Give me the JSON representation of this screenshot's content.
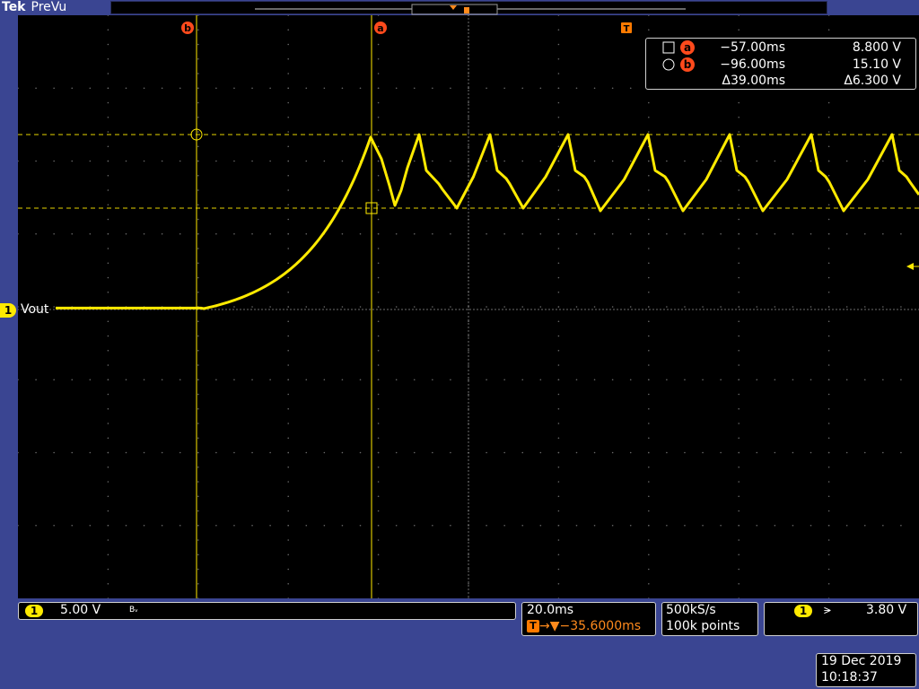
{
  "header": {
    "brand": "Tek",
    "mode": "PreVu"
  },
  "cursors": {
    "a": {
      "label": "a",
      "time": "−57.00ms",
      "voltage": "8.800 V"
    },
    "b": {
      "label": "b",
      "time": "−96.00ms",
      "voltage": "15.10 V"
    },
    "delta": {
      "time": "Δ39.00ms",
      "voltage": "Δ6.300 V"
    }
  },
  "trigger_marker": "T",
  "channel": {
    "number": "1",
    "name": "Vout",
    "scale": "5.00 V",
    "bw_badge": "Bᵥ"
  },
  "timebase": {
    "scale": "20.0ms",
    "position": "→▼−35.6000ms",
    "tag": "T"
  },
  "acquisition": {
    "rate": "500kS/s",
    "points": "100k points"
  },
  "trigger": {
    "channel": "1",
    "edge": "⪫",
    "level": "3.80 V"
  },
  "datetime": {
    "date": "19 Dec 2019",
    "time": "10:18:37"
  },
  "colors": {
    "trace": "#ffea00",
    "cursor": "#ff4a1c",
    "background": "#3a4592",
    "screen": "#000000"
  }
}
